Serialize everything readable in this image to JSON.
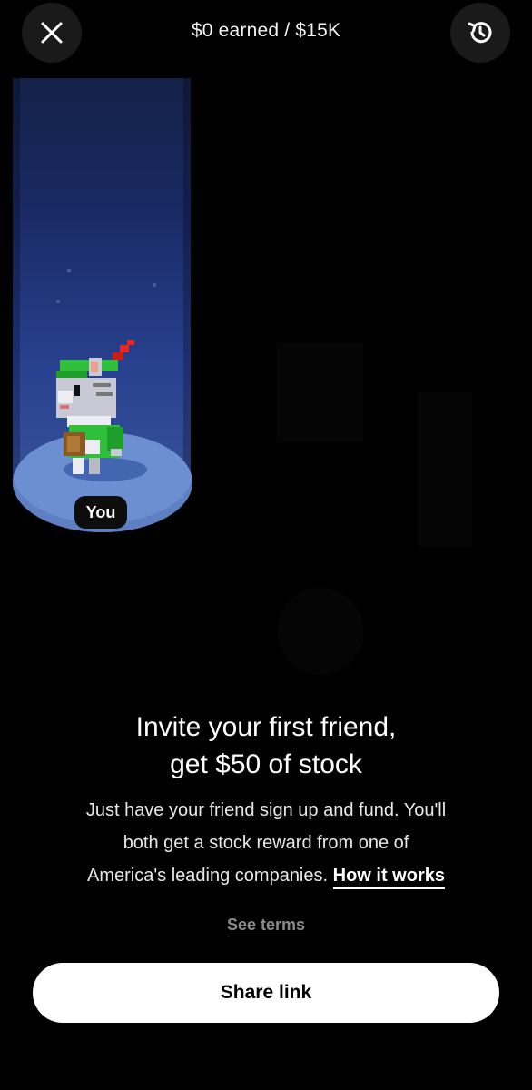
{
  "header": {
    "earned_text": "$0 earned / $15K",
    "close_icon": "close-icon",
    "history_icon": "history-icon"
  },
  "scene": {
    "you_label": "You",
    "character": "pixel-cat-character"
  },
  "content": {
    "headline_line1": "Invite your first friend,",
    "headline_line2": "get $50 of stock",
    "body_line1": "Just have your friend sign up and fund. You'll",
    "body_line2": "both get a stock reward from one of",
    "body_line3": "America's leading companies.",
    "how_it_works": "How it works",
    "see_terms": "See terms"
  },
  "actions": {
    "share_label": "Share link"
  },
  "colors": {
    "background": "#000000",
    "button_bg": "#ffffff",
    "spotlight": "#2a4496",
    "platform": "#6b8fd0"
  }
}
